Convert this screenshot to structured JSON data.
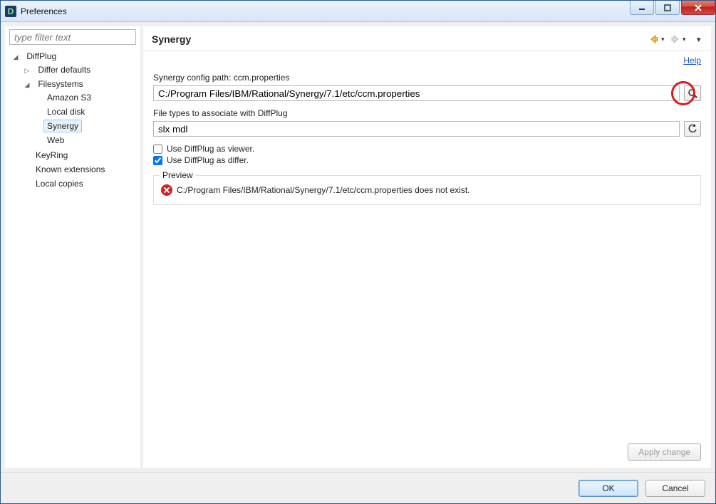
{
  "window": {
    "title": "Preferences"
  },
  "filter": {
    "placeholder": "type filter text"
  },
  "tree": {
    "root": "DiffPlug",
    "items": {
      "differ_defaults": "Differ defaults",
      "filesystems": "Filesystems",
      "amazon_s3": "Amazon S3",
      "local_disk": "Local disk",
      "synergy": "Synergy",
      "web": "Web",
      "keyring": "KeyRing",
      "known_extensions": "Known extensions",
      "local_copies": "Local copies"
    },
    "selected": "synergy"
  },
  "page": {
    "title": "Synergy",
    "help": "Help",
    "config_label": "Synergy config path: ccm.properties",
    "config_value": "C:/Program Files/IBM/Rational/Synergy/7.1/etc/ccm.properties",
    "filetypes_label": "File types to associate with DiffPlug",
    "filetypes_value": "slx mdl",
    "use_viewer_label": "Use DiffPlug as viewer.",
    "use_viewer_checked": false,
    "use_differ_label": "Use DiffPlug as differ.",
    "use_differ_checked": true,
    "preview_legend": "Preview",
    "preview_error": "C:/Program Files/IBM/Rational/Synergy/7.1/etc/ccm.properties does not exist.",
    "apply_label": "Apply change"
  },
  "footer": {
    "ok": "OK",
    "cancel": "Cancel"
  }
}
